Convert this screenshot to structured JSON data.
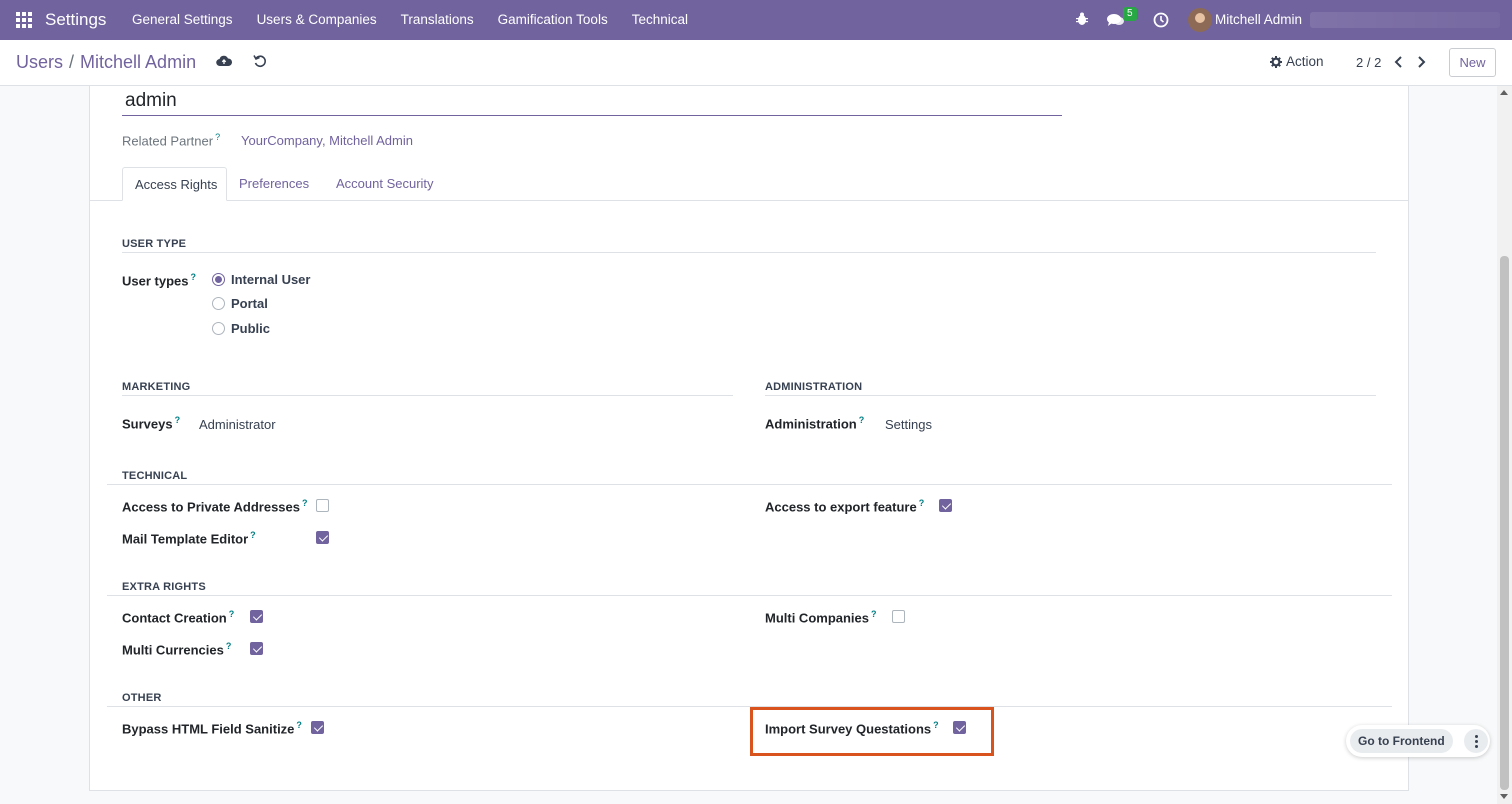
{
  "navbar": {
    "app_name": "Settings",
    "menu": [
      "General Settings",
      "Users & Companies",
      "Translations",
      "Gamification Tools",
      "Technical"
    ],
    "chat_badge": "5",
    "user_name": "Mitchell Admin",
    "icons": [
      "apps-grid-icon",
      "bug-icon",
      "chat-icon",
      "clock-icon"
    ]
  },
  "control": {
    "breadcrumb_parent": "Users",
    "breadcrumb_separator": "/",
    "breadcrumb_current": "Mitchell Admin",
    "action_label": "Action",
    "pager": "2 / 2",
    "new_label": "New"
  },
  "form": {
    "login": "admin",
    "related_partner_label": "Related Partner",
    "related_partner_value": "YourCompany, Mitchell Admin",
    "help_mark": "?",
    "tabs": [
      "Access Rights",
      "Preferences",
      "Account Security"
    ],
    "active_tab": "Access Rights"
  },
  "access": {
    "user_type_title": "USER TYPE",
    "user_types_label": "User types",
    "user_types": [
      {
        "label": "Internal User",
        "checked": true
      },
      {
        "label": "Portal",
        "checked": false
      },
      {
        "label": "Public",
        "checked": false
      }
    ],
    "marketing_title": "MARKETING",
    "surveys_label": "Surveys",
    "surveys_value": "Administrator",
    "administration_title": "ADMINISTRATION",
    "administration_label": "Administration",
    "administration_value": "Settings",
    "technical_title": "TECHNICAL",
    "private_addresses_label": "Access to Private Addresses",
    "private_addresses_checked": false,
    "export_label": "Access to export feature",
    "export_checked": true,
    "mail_template_label": "Mail Template Editor",
    "mail_template_checked": true,
    "extra_title": "EXTRA RIGHTS",
    "contact_creation_label": "Contact Creation",
    "contact_creation_checked": true,
    "multi_companies_label": "Multi Companies",
    "multi_companies_checked": false,
    "multi_currencies_label": "Multi Currencies",
    "multi_currencies_checked": true,
    "other_title": "OTHER",
    "bypass_label": "Bypass HTML Field Sanitize",
    "bypass_checked": true,
    "import_survey_label": "Import Survey Questations",
    "import_survey_checked": true
  },
  "floating": {
    "go_frontend": "Go to Frontend"
  },
  "colors": {
    "primary": "#71639e",
    "highlight": "#d9531e",
    "badge": "#28a745"
  }
}
